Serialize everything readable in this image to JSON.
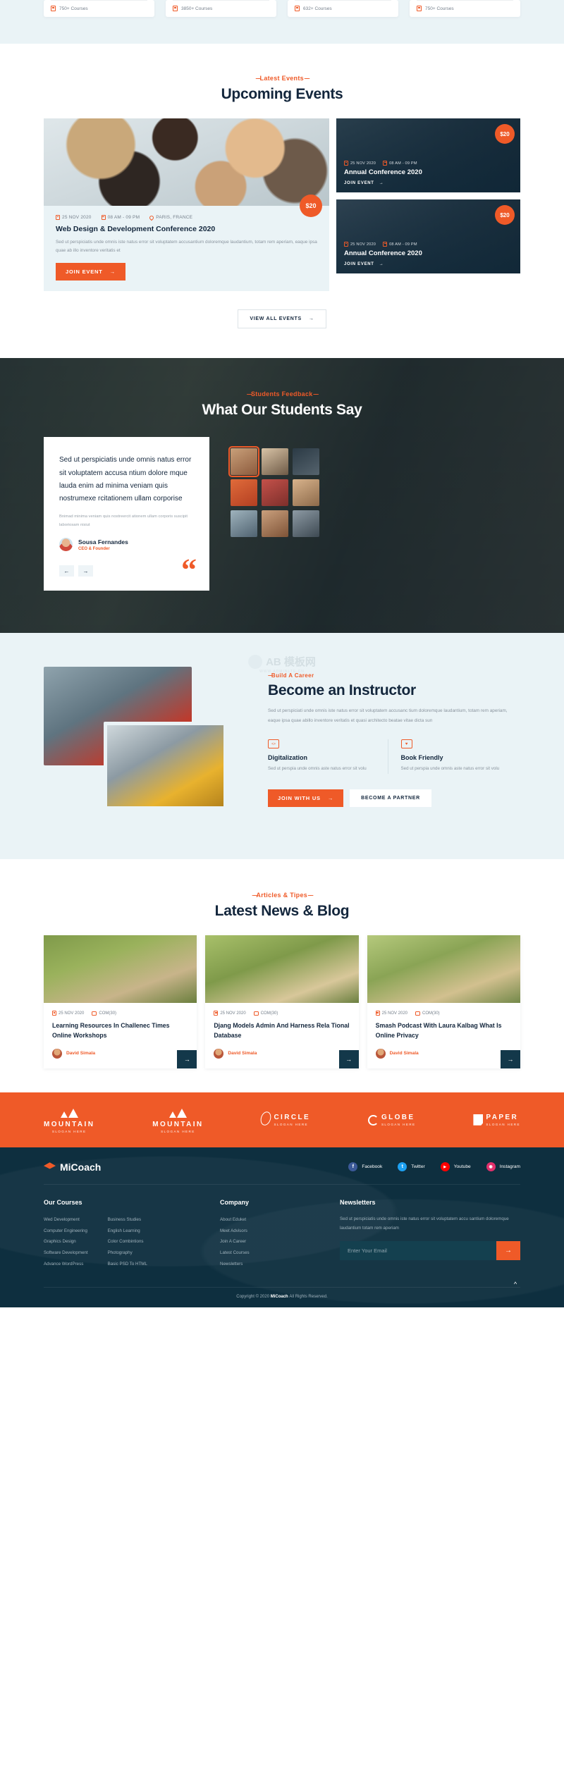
{
  "stats": {
    "cards": [
      {
        "icon": "book-icon",
        "label": "750+ Courses"
      },
      {
        "icon": "book-icon",
        "label": "3850+ Courses"
      },
      {
        "icon": "book-icon",
        "label": "632+ Courses"
      },
      {
        "icon": "book-icon",
        "label": "750+ Courses"
      }
    ]
  },
  "events": {
    "subtitle": "Latest Events",
    "title": "Upcoming Events",
    "featured": {
      "price": "$20",
      "date": "25 NOV 2020",
      "time": "08 AM - 09 PM",
      "location": "PARIS, FRANCE",
      "title": "Web Design & Development Conference 2020",
      "desc": "Sed ut perspiciatis unde omnis iste natus error sit voluptatem accusantium doloremque laudantium, totam rem aperiam, eaque ipsa quae ab illo inventore veritatis et",
      "cta": "JOIN EVENT"
    },
    "side": [
      {
        "price": "$20",
        "date": "25 NOV 2020",
        "time": "08 AM - 09 PM",
        "title": "Annual Conference 2020",
        "cta": "JOIN EVENT"
      },
      {
        "price": "$20",
        "date": "25 NOV 2020",
        "time": "08 AM - 09 PM",
        "title": "Annual Conference 2020",
        "cta": "JOIN EVENT"
      }
    ],
    "view_all": "VIEW ALL EVENTS"
  },
  "testimonials": {
    "subtitle": "Students Feedback",
    "title": "What Our Students Say",
    "quote": "Sed ut perspiciatis unde omnis natus error sit voluptatem accusa ntium dolore mque lauda enim ad minima veniam quis nostrumexe rcitationem ullam corporise",
    "sub": "Bnimad minima veniam quis nostreercit ationem ullam corporis suscipit laboriosam nisiut",
    "name": "Sousa Fernandes",
    "role": "CEO & Founder",
    "prev_icon": "arrow-left-icon",
    "next_icon": "arrow-right-icon",
    "quote_mark": "“"
  },
  "instructor": {
    "subtitle": "Build A Career",
    "title": "Become an Instructor",
    "desc": "Sed ut perspiciati unde omnis iste natus error sit voluptatem accusanc tium doloremque laudantium, totam rem aperiam, eaque ipsa quae abillo inventore veritatis et quasi architecto beatae vitae dicta sun",
    "features": [
      {
        "icon": "code-laptop-icon",
        "title": "Digitalization",
        "desc": "Sed ut perspia unde omnis aste natus error sit volu"
      },
      {
        "icon": "heart-book-icon",
        "title": "Book Friendly",
        "desc": "Sed ut perspia unde omnis aste natus error sit volu"
      }
    ],
    "primary_cta": "JOIN WITH US",
    "secondary_cta": "BECOME A PARTNER",
    "watermark": {
      "text": "AB 模板网",
      "sub": "WWW.ADMINLTE.CN"
    }
  },
  "blog": {
    "subtitle": "Articles & Tipes",
    "title": "Latest News & Blog",
    "posts": [
      {
        "date": "25 NOV 2020",
        "comments": "COM(30)",
        "title": "Learning Resources In Challenec Times Online Workshops",
        "author": "David Simala"
      },
      {
        "date": "25 NOV 2020",
        "comments": "COM(30)",
        "title": "Djang Models Admin And Harness Rela Tional Database",
        "author": "David Simala"
      },
      {
        "date": "25 NOV 2020",
        "comments": "COM(30)",
        "title": "Smash Podcast With Laura Kalbag What Is Online Privacy",
        "author": "David Simala"
      }
    ]
  },
  "brands": [
    {
      "mark": "mountain-icon",
      "name": "MOUNTAIN",
      "slogan": "SLOGAN HERE"
    },
    {
      "mark": "mountain-icon",
      "name": "MOUNTAIN",
      "slogan": "SLOGAN HERE"
    },
    {
      "mark": "circle-star-icon",
      "name": "CIRCLE",
      "slogan": "SLOGAN HERE"
    },
    {
      "mark": "globe-icon",
      "name": "GLOBE",
      "slogan": "SLOGAN HERE"
    },
    {
      "mark": "paper-icon",
      "name": "PAPER",
      "slogan": "SLOGAN HERE"
    }
  ],
  "footer": {
    "logo_text": "MiCoach",
    "socials": [
      {
        "name": "Facebook",
        "glyph": "f",
        "color": "#3b5998"
      },
      {
        "name": "Twitter",
        "glyph": "t",
        "color": "#1da1f2"
      },
      {
        "name": "Youtube",
        "glyph": "▶",
        "color": "#ff0000"
      },
      {
        "name": "Instagram",
        "glyph": "◉",
        "color": "#e1306c"
      }
    ],
    "courses": {
      "heading": "Our Courses",
      "col1": [
        "Wed Development",
        "Computer Engineering",
        "Graphics Design",
        "Software Development",
        "Advance WordPress"
      ],
      "col2": [
        "Business Studies",
        "English Learning",
        "Color Combintions",
        "Photography",
        "Basic PSD To HTML"
      ]
    },
    "company": {
      "heading": "Company",
      "items": [
        "About Eduket",
        "Meet Advisors",
        "Join A Career",
        "Latest Courses",
        "Newsletters"
      ]
    },
    "newsletters": {
      "heading": "Newsletters",
      "desc": "Sed ut perspiciatis unde omnis iste natus error sit voluptatem accu santium doloremque laudantium totam rem aperiam",
      "placeholder": "Enter Your Email",
      "submit_icon": "arrow-right-icon"
    },
    "copyright_prefix": "Copyright © 2020",
    "copyright_brand": "MiCoach",
    "copyright_suffix": "All Rights Reserved.",
    "to_top_icon": "chevron-up-icon"
  },
  "colors": {
    "accent": "#ef5a28",
    "dark": "#13263c",
    "footer": "#0e2f3f",
    "light": "#eaf3f6"
  }
}
